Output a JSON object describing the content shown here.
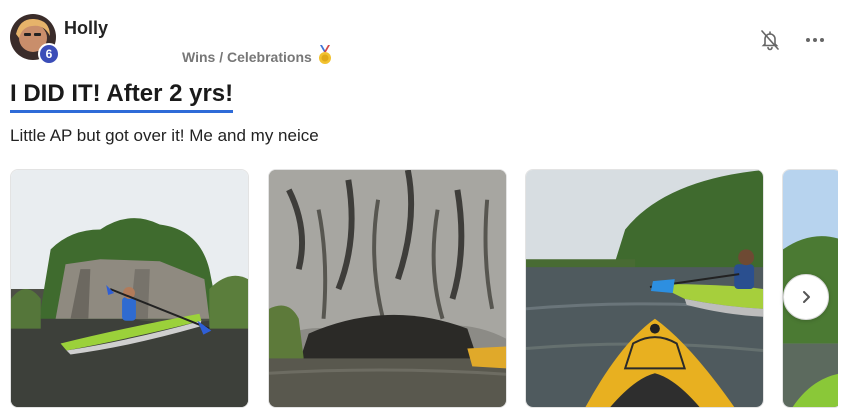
{
  "author": {
    "name": "Holly",
    "level": "6"
  },
  "post": {
    "category": "Wins / Celebrations",
    "category_icon": "medal-icon",
    "title": "I DID IT! After 2 yrs!",
    "body": "Little AP but got over it! Me and my neice"
  },
  "gallery": {
    "photos": [
      {
        "subject": "kayak-on-lake-photo"
      },
      {
        "subject": "rock-cliff-photo"
      },
      {
        "subject": "kayak-bow-photo"
      },
      {
        "subject": "partial-photo"
      }
    ],
    "next_icon": "chevron-right-icon"
  },
  "actions": {
    "notify_icon": "bell-off-icon",
    "more_icon": "more-horizontal-icon"
  },
  "colors": {
    "title_underline": "#2e6bd8",
    "badge": "#3b4db8"
  }
}
